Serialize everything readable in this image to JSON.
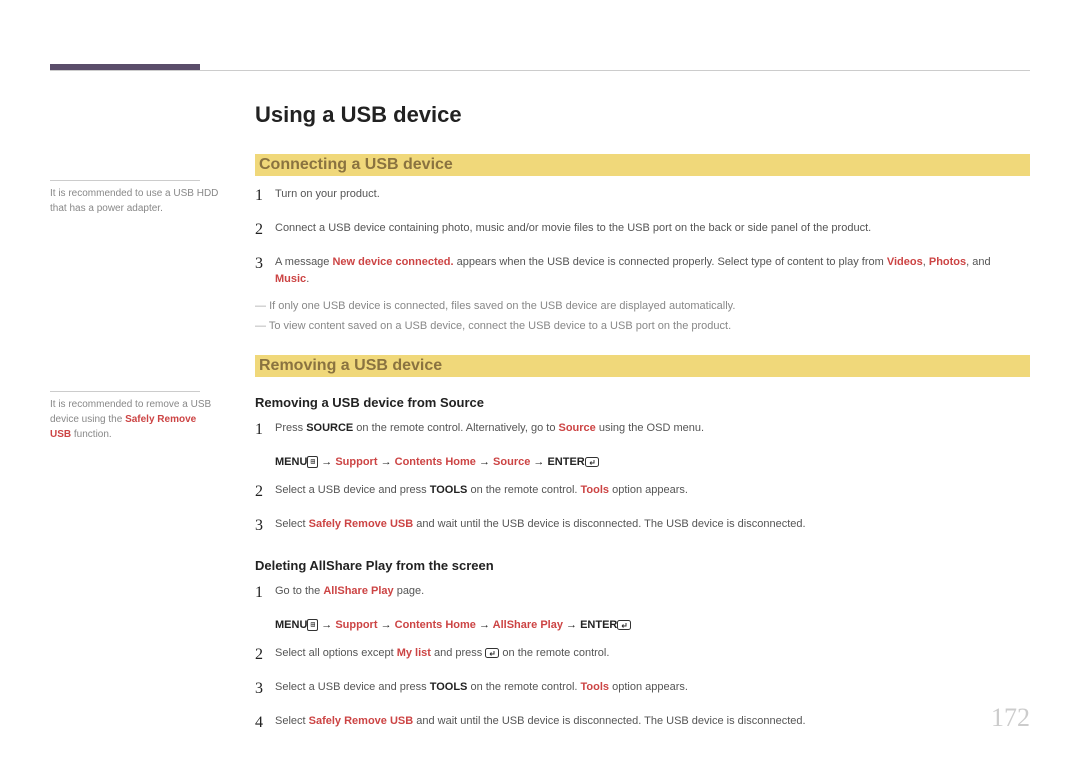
{
  "title": "Using a USB device",
  "sec1": {
    "heading": "Connecting a USB device",
    "side_note": "It is recommended to use a USB HDD that has a power adapter.",
    "steps": {
      "s1": "Turn on your product.",
      "s2": "Connect a USB device containing photo, music and/or movie files to the USB port on the back or side panel of the product.",
      "s3_a": "A message ",
      "s3_b": "New device connected.",
      "s3_c": " appears when the USB device is connected properly. Select type of content to play from ",
      "s3_v": "Videos",
      "s3_p": "Photos",
      "s3_and": ", and ",
      "s3_m": "Music",
      "s3_dot": "."
    },
    "note1": "If only one USB device is connected, files saved on the USB device are displayed automatically.",
    "note2": "To view content saved on a USB device, connect the USB device to a USB port on the product."
  },
  "sec2": {
    "heading": "Removing a USB device",
    "side_a": "It is recommended to remove a USB device using the ",
    "side_b": "Safely Remove USB",
    "side_c": " function.",
    "sub1": {
      "heading": "Removing a USB device from Source",
      "s1_a": "Press ",
      "s1_b": "SOURCE",
      "s1_c": " on the remote control. Alternatively, go to ",
      "s1_d": "Source",
      "s1_e": " using the OSD menu.",
      "path_menu": "MENU",
      "path_support": "Support",
      "path_contents": "Contents Home",
      "path_source": "Source",
      "path_enter": "ENTER",
      "s2_a": "Select a USB device and press ",
      "s2_b": "TOOLS",
      "s2_c": " on the remote control. ",
      "s2_d": "Tools",
      "s2_e": " option appears.",
      "s3_a": "Select ",
      "s3_b": "Safely Remove USB",
      "s3_c": " and wait until the USB device is disconnected. The USB device is disconnected."
    },
    "sub2": {
      "heading": "Deleting AllShare Play from the screen",
      "s1_a": "Go to the ",
      "s1_b": "AllShare Play",
      "s1_c": " page.",
      "path_menu": "MENU",
      "path_support": "Support",
      "path_contents": "Contents Home",
      "path_allshare": "AllShare Play",
      "path_enter": "ENTER",
      "s2_a": "Select all options except ",
      "s2_b": "My list",
      "s2_c": " and press ",
      "s2_d": " on the remote control.",
      "s3_a": "Select a USB device and press ",
      "s3_b": "TOOLS",
      "s3_c": " on the remote control. ",
      "s3_d": "Tools",
      "s3_e": " option appears.",
      "s4_a": "Select ",
      "s4_b": "Safely Remove USB",
      "s4_c": " and wait until the USB device is disconnected. The USB device is disconnected."
    }
  },
  "page_number": "172",
  "nums": {
    "n1": "1",
    "n2": "2",
    "n3": "3",
    "n4": "4"
  },
  "sep": {
    "comma": ", ",
    "arrow": " → "
  }
}
